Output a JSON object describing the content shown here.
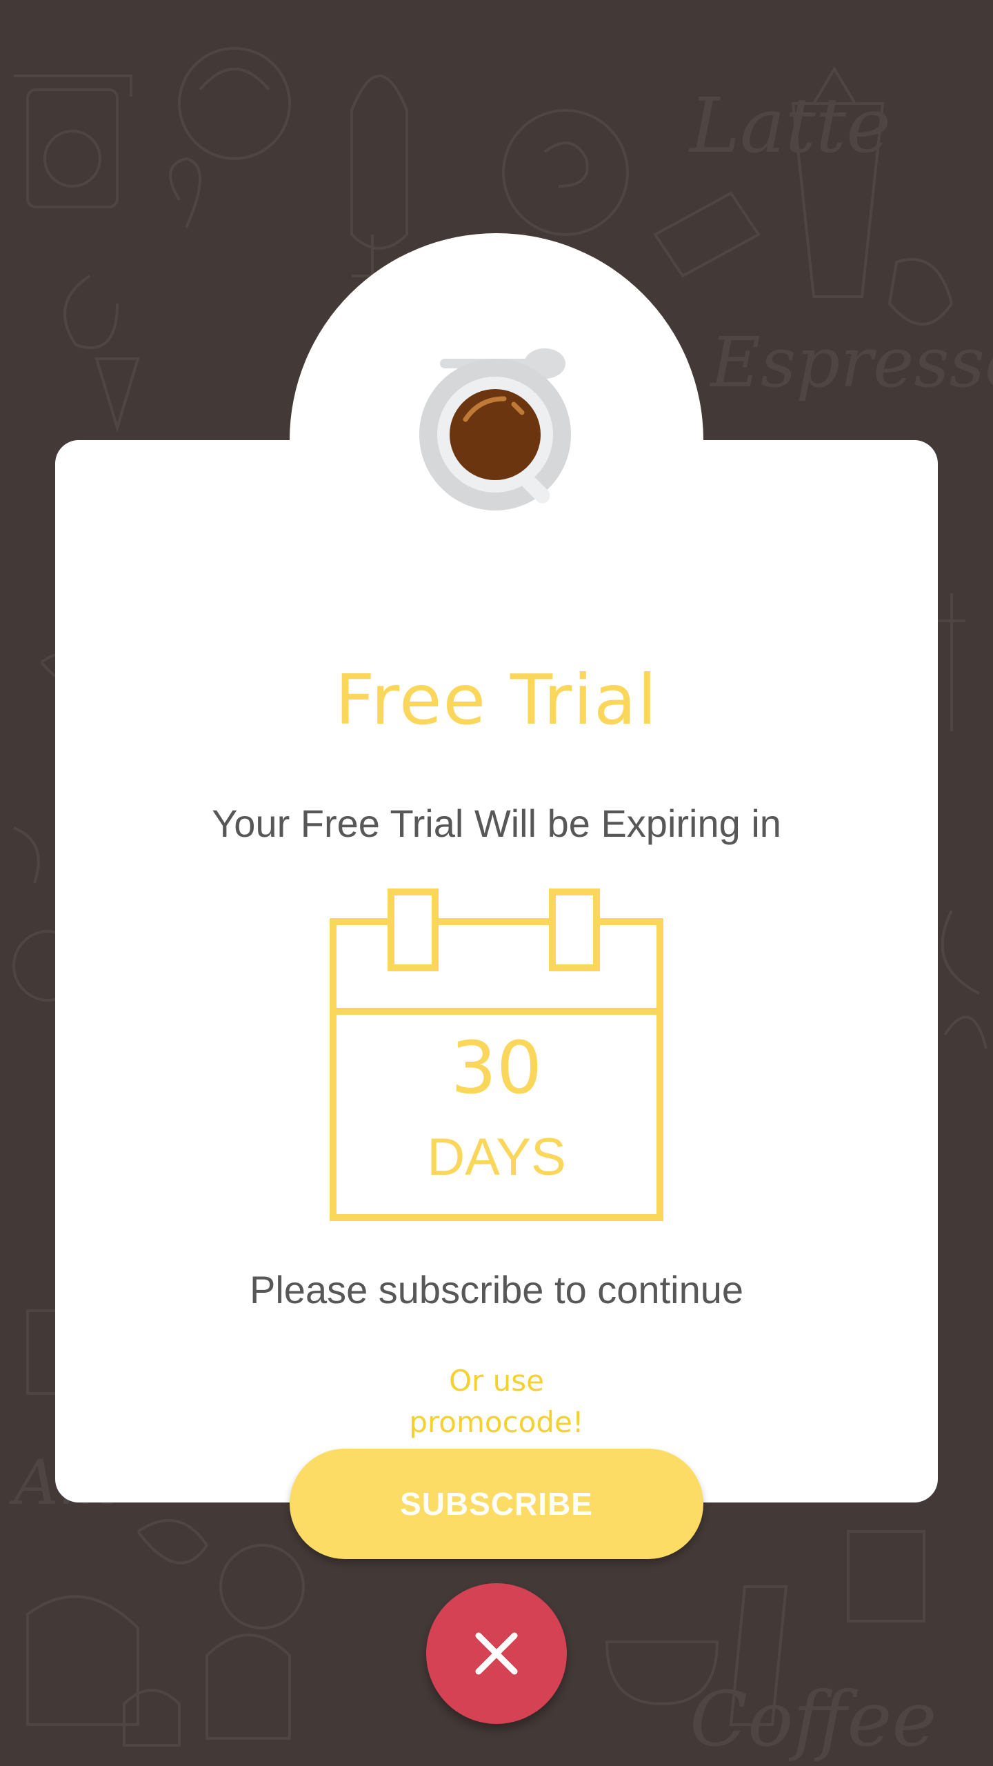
{
  "dialog": {
    "title": "Free Trial",
    "subtitle": "Your Free Trial Will be Expiring in",
    "calendar": {
      "number": "30",
      "unit": "DAYS"
    },
    "continue_text": "Please subscribe to continue",
    "promo_link": "Or use promocode!",
    "subscribe_label": "SUBSCRIBE"
  },
  "icons": {
    "header": "coffee-cup-icon",
    "close": "close-icon"
  },
  "colors": {
    "background": "#433937",
    "card": "#ffffff",
    "accent_yellow": "#fad75a",
    "button_yellow": "#fcdc64",
    "text_gray": "#575757",
    "close_red": "#d44254",
    "coffee_brown": "#6b3510"
  }
}
